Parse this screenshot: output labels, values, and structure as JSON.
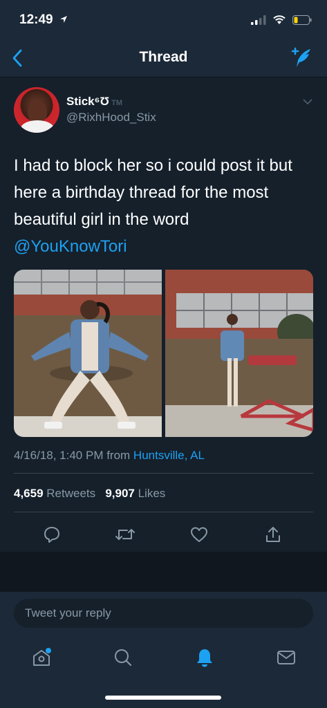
{
  "status": {
    "time": "12:49"
  },
  "nav": {
    "title": "Thread"
  },
  "tweet": {
    "display_name": "Stick⁶Ʊ",
    "tm": "TM",
    "handle": "@RixhHood_Stix",
    "text_lines": [
      "I had to block her so i could post it but",
      "here a birthday thread for the most",
      "beautiful girl in the word"
    ],
    "mention": "@YouKnowTori",
    "timestamp": "4/16/18, 1:40 PM from ",
    "location": "Huntsville, AL",
    "retweets_count": "4,659",
    "retweets_label": "Retweets",
    "likes_count": "9,907",
    "likes_label": "Likes"
  },
  "reply": {
    "placeholder": "Tweet your reply"
  },
  "colors": {
    "accent": "#1da1f2",
    "background": "#15202b",
    "bar": "#1c2938",
    "secondary_text": "#8899a6"
  },
  "icons": {
    "nav": [
      "back-chevron-icon",
      "compose-tweet-icon"
    ],
    "actions": [
      "reply-icon",
      "retweet-icon",
      "like-icon",
      "share-icon"
    ],
    "tabs": [
      "home-icon",
      "search-icon",
      "notifications-icon",
      "messages-icon"
    ]
  }
}
